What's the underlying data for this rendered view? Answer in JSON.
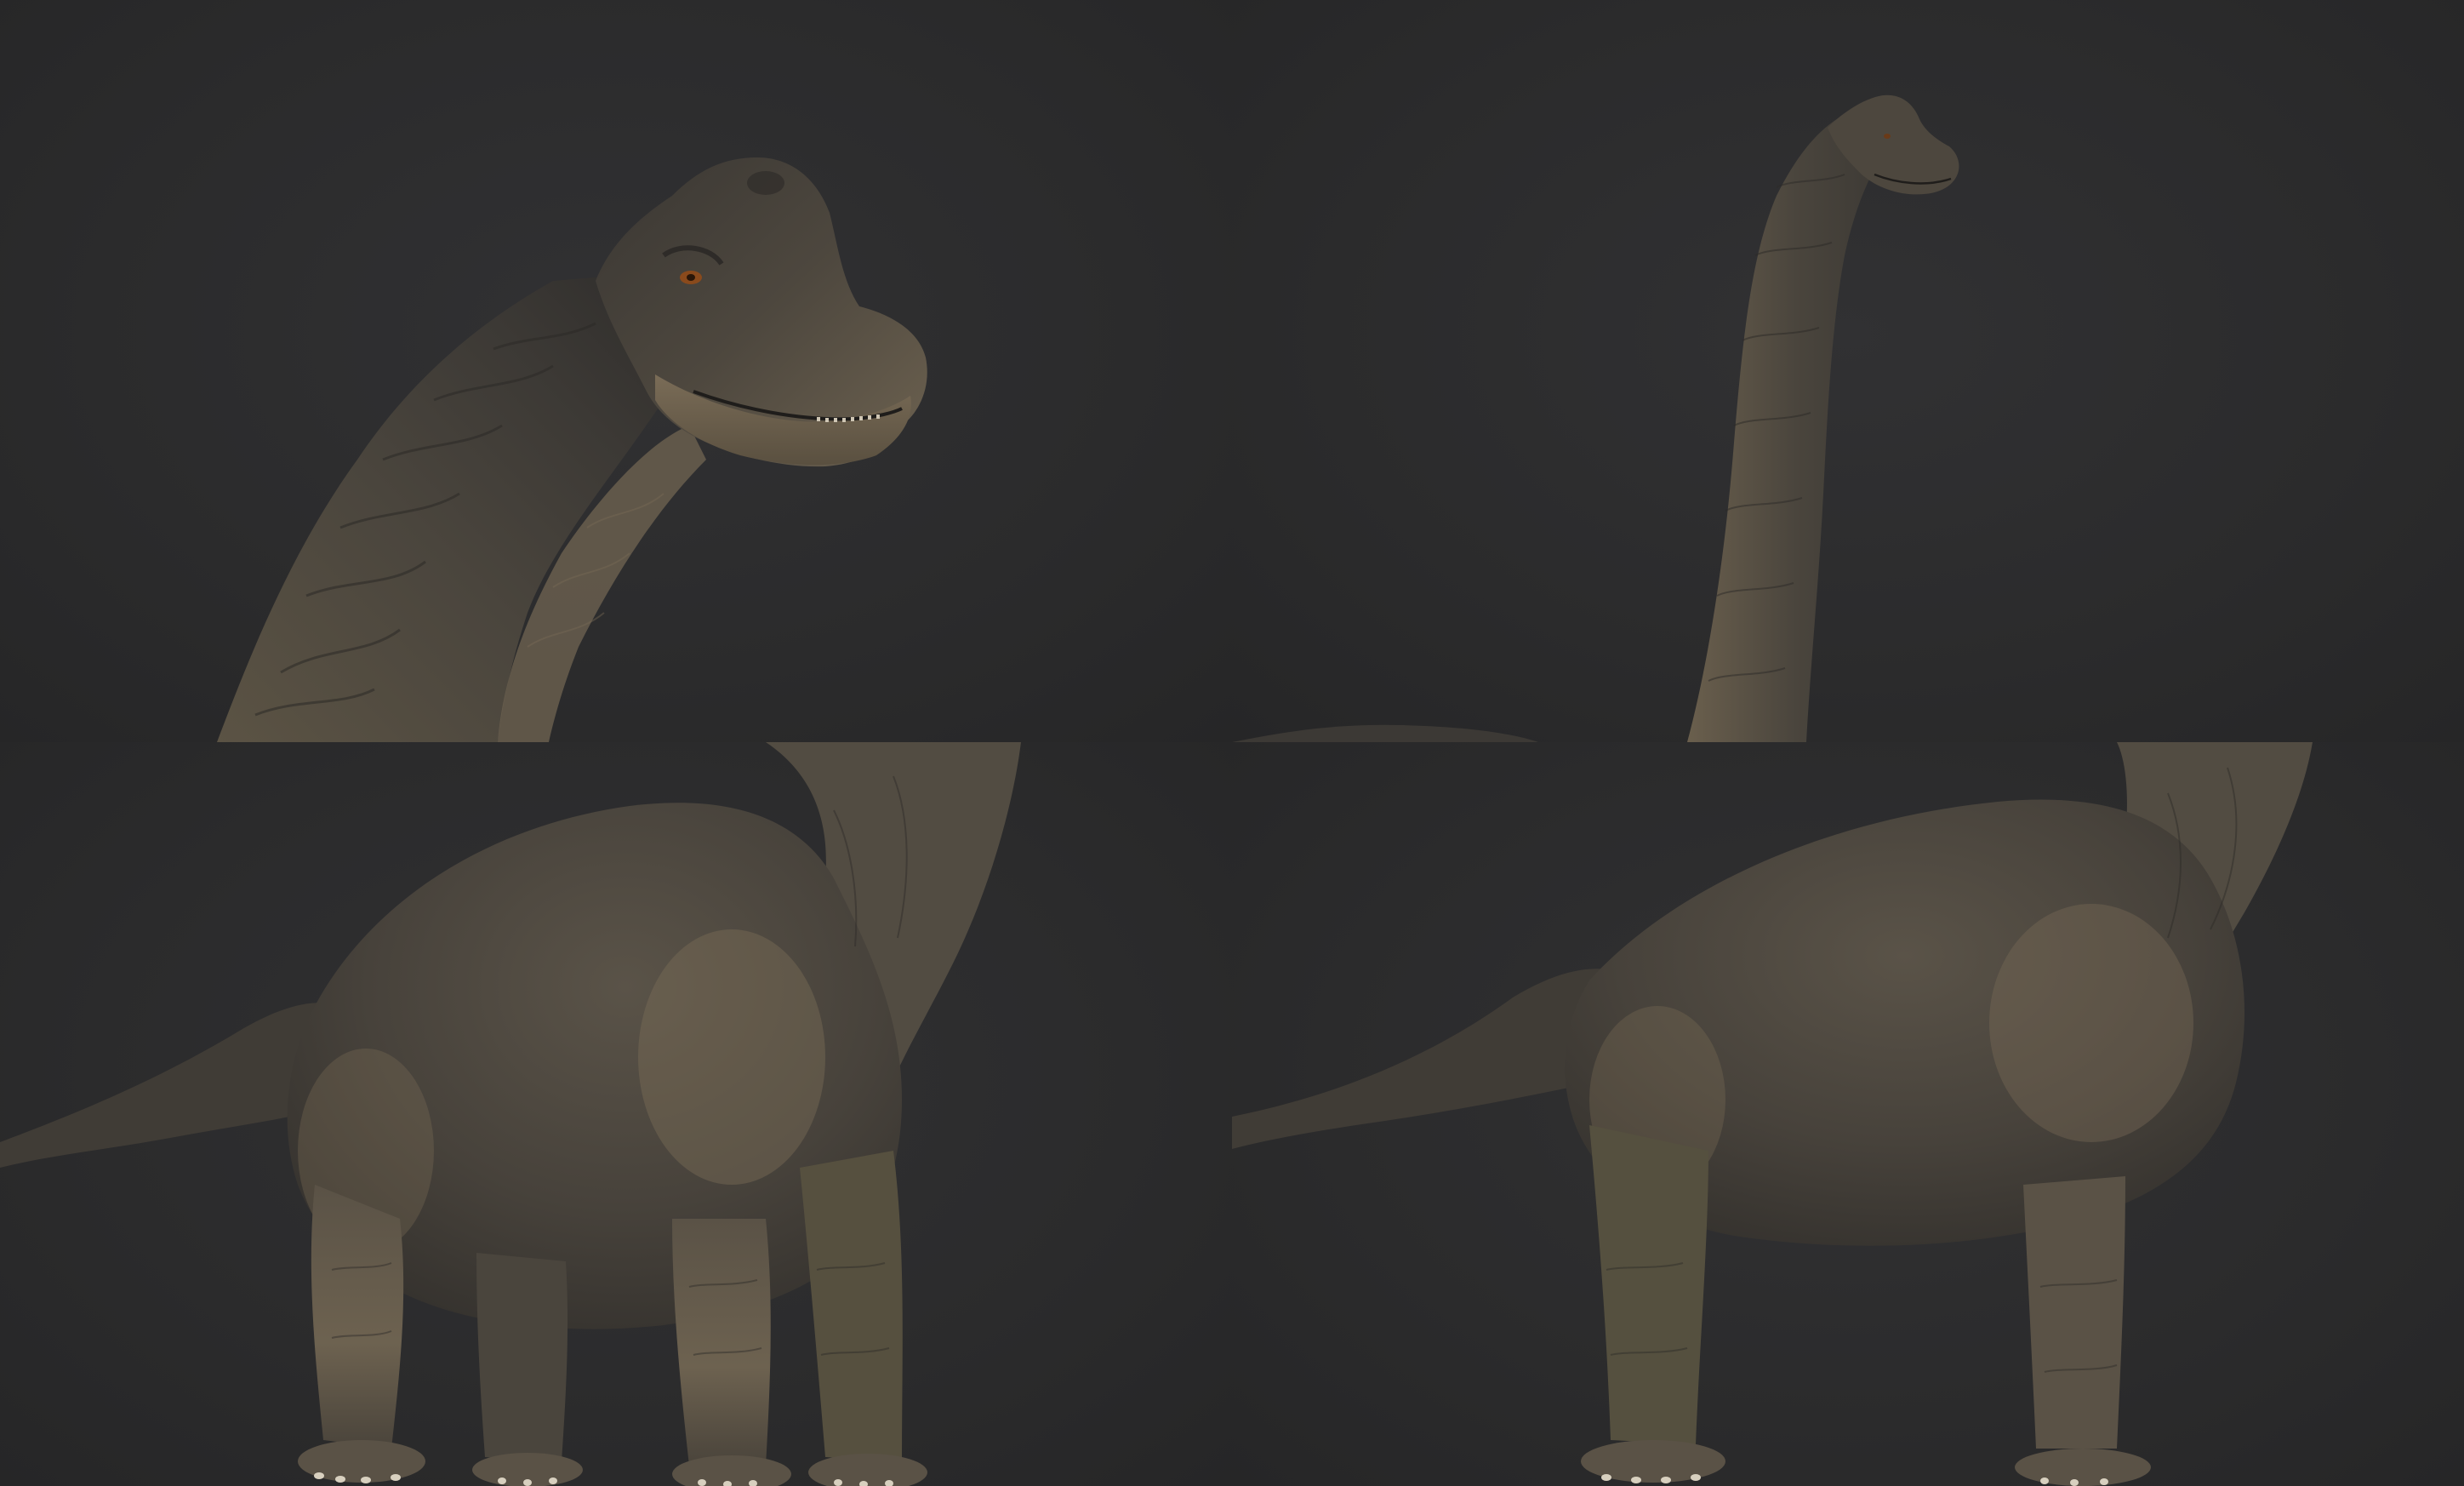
{
  "title": "",
  "panels": [
    {
      "view": "head-closeup",
      "subject": "brachiosaurus-head"
    },
    {
      "view": "neck-full",
      "subject": "brachiosaurus-neck"
    },
    {
      "view": "body-front-three-quarter",
      "subject": "brachiosaurus-body"
    },
    {
      "view": "body-side",
      "subject": "brachiosaurus-body"
    }
  ],
  "colors": {
    "background": "#2a2a2b",
    "skin_dark": "#3e3b36",
    "skin_mid": "#5a5246",
    "skin_light": "#8a7a62",
    "eye": "#8a4a1c"
  }
}
